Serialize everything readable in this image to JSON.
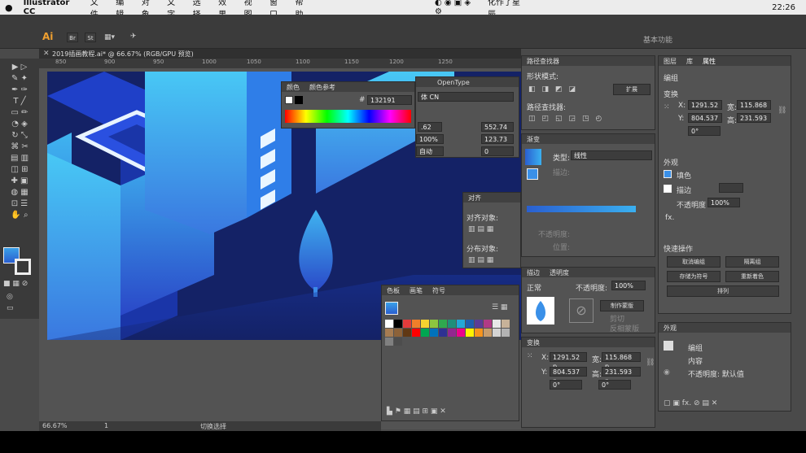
{
  "menubar": {
    "items": [
      "Illustrator CC",
      "文件",
      "编辑",
      "对象",
      "文字",
      "选择",
      "效果",
      "视图",
      "窗口",
      "帮助"
    ],
    "center_text": "化作了星辰",
    "time": "22:26"
  },
  "app": {
    "ai_badge": "Ai",
    "br_badge": "Br",
    "st_badge": "St",
    "workspace": "基本功能"
  },
  "document": {
    "tab_title": "2019插画教程.ai* @ 66.67% (RGB/GPU 预览)"
  },
  "ruler": {
    "ticks": [
      "850",
      "900",
      "950",
      "1000",
      "1050",
      "1100",
      "1150",
      "1200",
      "1250"
    ]
  },
  "color_panel": {
    "tabs": [
      "颜色",
      "颜色参考"
    ],
    "hex_label": "#",
    "hex_value": "132191"
  },
  "char_panel": {
    "tab": "OpenType",
    "font": "体 CN",
    "size": ".62",
    "tracking": "552.74",
    "scale": "100%",
    "leading": "123.73",
    "baseline_value": "自动",
    "rotation": "0"
  },
  "pathfinder": {
    "title": "路径查找器",
    "shape_modes": "形状模式:",
    "expand": "扩展",
    "pathfinders": "路径查找器:"
  },
  "gradient": {
    "title": "渐变",
    "type_label": "类型:",
    "type_value": "线性",
    "stroke_label": "描边:",
    "opacity_label": "不透明度:",
    "location_label": "位置:"
  },
  "transparency": {
    "tabs": [
      "描边",
      "透明度"
    ],
    "mode": "正常",
    "opacity_label": "不透明度:",
    "opacity_value": "100%",
    "make_mask": "制作蒙版",
    "clip": "剪切",
    "invert": "反相蒙版"
  },
  "align": {
    "title": "对齐",
    "align_objects": "对齐对象:",
    "distribute": "分布对象:"
  },
  "swatches": {
    "tabs": [
      "色板",
      "画笔",
      "符号"
    ],
    "colors": [
      "#ffffff",
      "#000000",
      "#e23b3b",
      "#f07f2a",
      "#f6d230",
      "#8cc63f",
      "#2fa84f",
      "#1f8f7a",
      "#23a7d8",
      "#1f5fae",
      "#5b3c96",
      "#b13a86",
      "#e8e8e8",
      "#c7b299",
      "#a67c52",
      "#8c6239",
      "#603813",
      "#ff0000",
      "#00a651",
      "#0072bc",
      "#2e3192",
      "#92278f",
      "#ec008c",
      "#fff200",
      "#f7941d",
      "#c69c6d",
      "#d4d4d4",
      "#b3b3b3",
      "#808080",
      "#4d4d4d"
    ]
  },
  "transform": {
    "title": "变换",
    "x_label": "X:",
    "x": "1291.52 p",
    "w_label": "宽:",
    "w": "115.868 p",
    "y_label": "Y:",
    "y": "804.537 p",
    "h_label": "高:",
    "h": "231.593 p",
    "angle1": "0°",
    "angle2": "0°"
  },
  "properties": {
    "tabs": [
      "图层",
      "库",
      "属性"
    ],
    "group": "编组",
    "transform": "变换",
    "x_label": "X:",
    "x": "1291.52",
    "w_label": "宽:",
    "w": "115.868",
    "y_label": "Y:",
    "y": "804.537",
    "h_label": "高:",
    "h": "231.593",
    "angle": "0°",
    "appearance": "外观",
    "fill": "填色",
    "stroke": "描边",
    "opacity_label": "不透明度",
    "opacity": "100%",
    "fx": "fx.",
    "quick_actions": "快速操作",
    "ungroup": "取消编组",
    "isolate": "隔离组",
    "save_symbol": "存储为符号",
    "recolor": "重新着色",
    "arrange": "排列"
  },
  "appearance": {
    "title": "外观",
    "group": "编组",
    "content": "内容",
    "opacity": "不透明度: 默认值"
  },
  "status": {
    "zoom": "66.67%",
    "page": "1",
    "tool": "切换选择"
  }
}
